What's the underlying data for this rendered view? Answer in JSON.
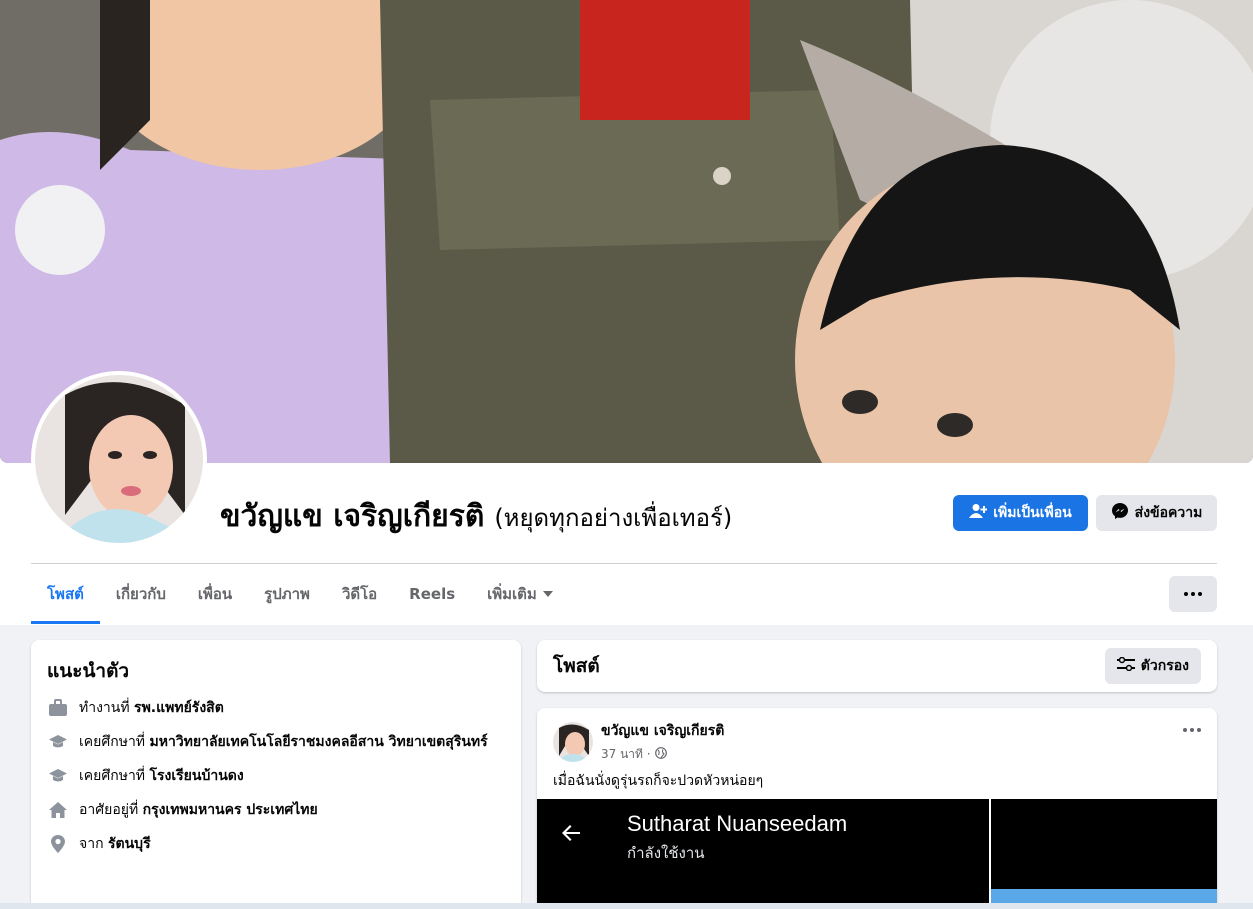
{
  "profile": {
    "name": "ขวัญแข เจริญเกียรติ",
    "alt_name": "(หยุดทุกอย่างเพื่อเทอร์)",
    "add_friend_label": "เพิ่มเป็นเพื่อน",
    "message_label": "ส่งข้อความ"
  },
  "tabs": [
    {
      "label": "โพสต์",
      "active": true
    },
    {
      "label": "เกี่ยวกับ"
    },
    {
      "label": "เพื่อน"
    },
    {
      "label": "รูปภาพ"
    },
    {
      "label": "วิดีโอ"
    },
    {
      "label": "Reels"
    },
    {
      "label": "เพิ่มเติม"
    }
  ],
  "intro": {
    "title": "แนะนำตัว",
    "items": [
      {
        "icon": "briefcase-icon",
        "prefix": "ทำงานที่ ",
        "value": "รพ.แพทย์รังสิต"
      },
      {
        "icon": "graduation-cap-icon",
        "prefix": "เคยศึกษาที่ ",
        "value": "มหาวิทยาลัยเทคโนโลยีราชมงคลอีสาน วิทยาเขตสุรินทร์"
      },
      {
        "icon": "graduation-cap-icon",
        "prefix": "เคยศึกษาที่ ",
        "value": "โรงเรียนบ้านดง"
      },
      {
        "icon": "home-icon",
        "prefix": "อาศัยอยู่ที่ ",
        "value": "กรุงเทพมหานคร ประเทศไทย"
      },
      {
        "icon": "location-pin-icon",
        "prefix": "จาก ",
        "value": "รัตนบุรี"
      }
    ]
  },
  "posts": {
    "title": "โพสต์",
    "filter_label": "ตัวกรอง"
  },
  "post": {
    "author": "ขวัญแข เจริญเกียรติ",
    "time": "37 นาที ·",
    "text": "เมื่อฉันนั่งดูรุ่นรถก็จะปวดหัวหน่อยๆ",
    "media_name": "Sutharat Nuanseedam",
    "media_status": "กำลังใช้งาน"
  },
  "colors": {
    "accent": "#1877f2",
    "button_primary": "#1b74e4",
    "button_secondary": "#e4e6eb",
    "page_bg": "#f0f2f5"
  }
}
